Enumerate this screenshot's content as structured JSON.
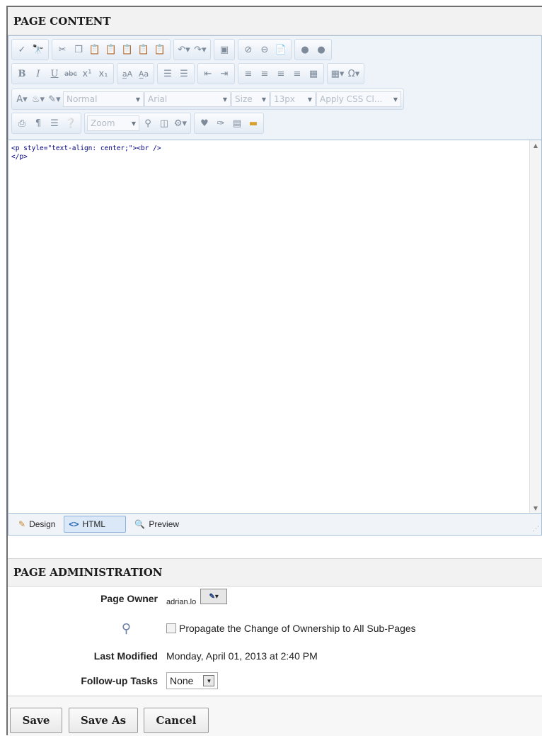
{
  "page_content": {
    "title": "PAGE CONTENT",
    "toolbar": {
      "style_dropdown": "Normal",
      "font_dropdown": "Arial",
      "size_dropdown": "Size",
      "px_dropdown": "13px",
      "css_dropdown": "Apply CSS Cl...",
      "zoom_dropdown": "Zoom"
    },
    "html_source": "<p style=\"text-align: center;\"><br />\n</p>",
    "mode_tabs": [
      {
        "label": "Design",
        "icon": "pencil-icon"
      },
      {
        "label": "HTML",
        "icon": "code-icon"
      },
      {
        "label": "Preview",
        "icon": "magnifier-icon"
      }
    ],
    "active_mode": "HTML"
  },
  "page_administration": {
    "title": "PAGE ADMINISTRATION",
    "page_owner_label": "Page Owner",
    "page_owner_value": "adrian.lo",
    "propagate_label": "Propagate the Change of Ownership to All Sub-Pages",
    "propagate_checked": false,
    "last_modified_label": "Last Modified",
    "last_modified_value": "Monday, April 01, 2013 at 2:40 PM",
    "followup_label": "Follow-up Tasks",
    "followup_value": "None"
  },
  "buttons": {
    "save": "Save",
    "save_as": "Save As",
    "cancel": "Cancel"
  }
}
